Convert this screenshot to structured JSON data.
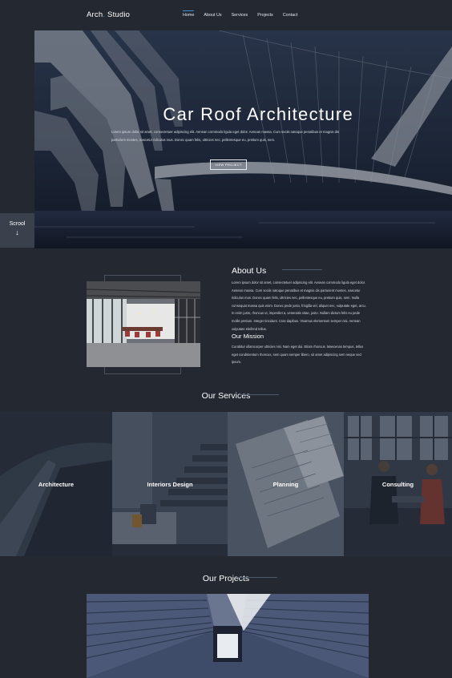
{
  "nav": {
    "logo_left": "Arch",
    "logo_dot": ".",
    "logo_right": "Studio",
    "items": [
      {
        "label": "Home",
        "active": true
      },
      {
        "label": "About Us",
        "active": false
      },
      {
        "label": "Services",
        "active": false
      },
      {
        "label": "Projects",
        "active": false
      },
      {
        "label": "Contact",
        "active": false
      }
    ]
  },
  "hero": {
    "title": "Car Roof Architecture",
    "text": "Lorem ipsum dolor sit amet, consectetuer adipiscing elit. Aenean commodo ligula eget dolor. Aenean massa. Cum sociis natoque penatibus et magnis dis parturient montes, nascetur ridiculus mus. Donec quam felis, ultricies nec, pellentesque eu, pretium quis, sem.",
    "button": "VIEW PROJECT"
  },
  "scroll": {
    "label": "Scrool",
    "arrow": "↓"
  },
  "about": {
    "title": "About Us",
    "text": "Lorem ipsum dolor sit amet, consectetuer adipiscing elit. Aenean commodo ligula eget dolor. Aenean massa. Cum sociis natoque penatibus et magnis dis parturient montes, nascetur ridiculus mus. Donec quam felis, ultricies nec, pellentesque eu, pretium quis, sem. Nulla consequat massa quis enim. Donec pede justo, fringilla vel, aliquet nec, vulputate eget, arcu. In enim justo, rhoncus ut, imperdiet a, venenatis vitae, justo. Nullam dictum felis eu pede mollis pretium. Integer tincidunt. Cras dapibus. Vivamus elementum semper nisi. Aenean vulputate eleifend tellus.",
    "mission_title": "Our Mission",
    "mission_text": "Curabitur ullamcorper ultricies nisi. Nam eget dui. Etiam rhoncus. Maecenas tempus, tellus eget condimentum rhoncus, sem quam semper libero, sit amet adipiscing sem neque sed ipsum."
  },
  "services": {
    "title": "Our Services",
    "items": [
      {
        "label": "Architecture"
      },
      {
        "label": "Interiors Design"
      },
      {
        "label": "Planning"
      },
      {
        "label": "Consulting"
      }
    ]
  },
  "projects": {
    "title": "Our Projects"
  },
  "colors": {
    "background": "#232831",
    "accent": "#3b8fd6",
    "divider": "#4f5a6a"
  }
}
